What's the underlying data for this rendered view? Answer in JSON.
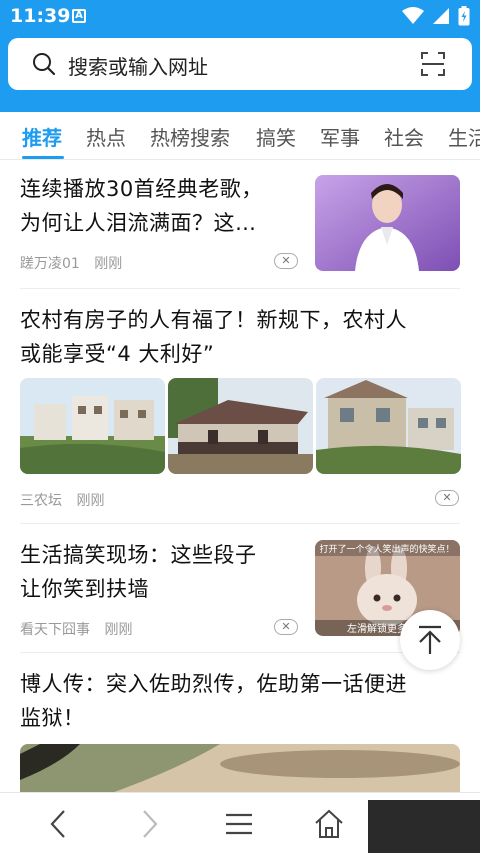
{
  "status": {
    "time": "11:39",
    "notif_letter": "A"
  },
  "search": {
    "placeholder": "搜索或输入网址"
  },
  "tabs": [
    "推荐",
    "热点",
    "热榜搜索",
    "搞笑",
    "军事",
    "社会",
    "生活"
  ],
  "active_tab": 0,
  "accent_color": "#1e9cf0",
  "feed": [
    {
      "title_lines": [
        "连续播放30首经典老歌，",
        "为何让人泪流满面？这…"
      ],
      "source": "蹉万凌01",
      "time": "刚刚",
      "thumb": "woman-portrait"
    },
    {
      "title_lines": [
        "农村有房子的人有福了！新规下，农村人",
        "或能享受“4 大利好”"
      ],
      "source": "三农坛",
      "time": "刚刚",
      "thumbs": [
        "village-houses-1",
        "village-house-2",
        "village-house-3"
      ]
    },
    {
      "title_lines": [
        "生活搞笑现场：这些段子",
        "让你笑到扶墙"
      ],
      "source": "看天下囧事",
      "time": "刚刚",
      "thumb": "bunny-plush",
      "thumb_caption_top": "打开了一个令人笑出声的快笑点！",
      "thumb_caption_bottom": "左滑解锁更多精彩"
    },
    {
      "title_lines": [
        "博人传：突入佐助烈传，佐助第一话便进",
        "监狱！"
      ],
      "thumb": "anime-scene"
    }
  ],
  "icons": {
    "fab": "scroll-top-icon",
    "back": "back-icon",
    "forward": "forward-icon",
    "menu": "menu-icon",
    "home": "home-icon",
    "search": "search-icon",
    "scan": "scan-icon"
  }
}
